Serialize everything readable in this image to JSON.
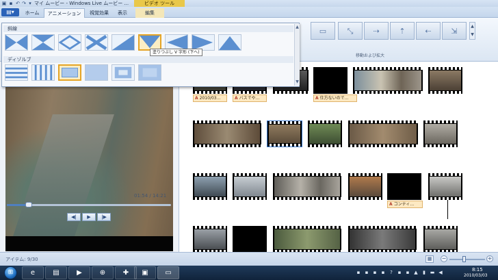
{
  "window": {
    "title": "マイ ムービー - Windows Live ムービー ...",
    "contextual_tab_header": "ビデオ ツール"
  },
  "ribbon_tabs": {
    "file_glyph": "▤▾",
    "home": "ホーム",
    "animations": "アニメーション",
    "visual_effects": "視覚効果",
    "view": "表示",
    "edit": "編集",
    "active": "アニメーション"
  },
  "ribbon": {
    "pan_zoom_group_label": "移動および拡大"
  },
  "transitions_gallery": {
    "category_diagonals": "斜線",
    "category_dissolves": "ディゾルブ",
    "tooltip": "塗りつぶし V 字形 (下へ)",
    "selected_item": "fill-v-down",
    "dissolve_selected_index": 2
  },
  "preview": {
    "time_display": "01:54 / 14:21",
    "playback_progress": 0.132,
    "previous_frame_symbol": "◀|",
    "play_symbol": "▶",
    "next_frame_symbol": "|▶"
  },
  "storyboard": {
    "captions": [
      "2010/03…",
      "バスでや…",
      "仕方ないので…",
      "コンティ…"
    ],
    "caption_icon": "A"
  },
  "statusbar": {
    "items_text": "アイテム: 9/30",
    "zoom_minus": "−",
    "zoom_plus": "+",
    "zoom_level": 0.42
  },
  "taskbar": {
    "start_symbol": "⊞",
    "clock_time": "8:15",
    "clock_date": "2010/03/03",
    "pinned": [
      "ie",
      "explorer",
      "media-player",
      "hp",
      "app",
      "movie-maker",
      "folder"
    ]
  }
}
